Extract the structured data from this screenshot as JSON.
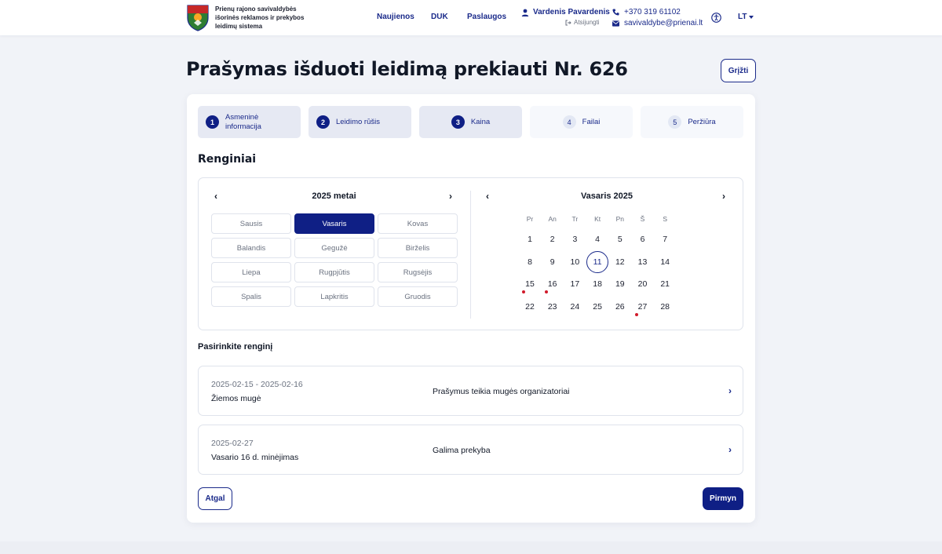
{
  "header": {
    "org_name": "Prienų rajono savivaldybės išorinės reklamos ir prekybos leidimų sistema",
    "nav": [
      "Naujienos",
      "DUK",
      "Paslaugos"
    ],
    "user_name": "Vardenis Pavardenis",
    "logout_label": "Atsijungti",
    "phone": "+370 319 61102",
    "email": "savivaldybe@prienai.lt",
    "language": "LT"
  },
  "page": {
    "title": "Prašymas išduoti leidimą prekiauti Nr. 626",
    "back_label": "Grįžti"
  },
  "steps": [
    {
      "num": "1",
      "label": "Asmeninė informacija",
      "state": "active"
    },
    {
      "num": "2",
      "label": "Leidimo rūšis",
      "state": "active"
    },
    {
      "num": "3",
      "label": "Kaina",
      "state": "active"
    },
    {
      "num": "4",
      "label": "Failai",
      "state": "inactive"
    },
    {
      "num": "5",
      "label": "Peržiūra",
      "state": "inactive"
    }
  ],
  "events_section": {
    "title": "Renginiai",
    "year_label": "2025 metai",
    "months": [
      "Sausis",
      "Vasaris",
      "Kovas",
      "Balandis",
      "Gegužė",
      "Birželis",
      "Liepa",
      "Rugpjūtis",
      "Rugsėjis",
      "Spalis",
      "Lapkritis",
      "Gruodis"
    ],
    "selected_month": "Vasaris",
    "calendar_label": "Vasaris 2025",
    "weekdays": [
      "Pr",
      "An",
      "Tr",
      "Kt",
      "Pn",
      "Š",
      "S"
    ],
    "weeks": [
      [
        "1",
        "2",
        "3",
        "4",
        "5",
        "6",
        "7"
      ],
      [
        "8",
        "9",
        "10",
        "11",
        "12",
        "13",
        "14"
      ],
      [
        "15",
        "16",
        "17",
        "18",
        "19",
        "20",
        "21"
      ],
      [
        "22",
        "23",
        "24",
        "25",
        "26",
        "27",
        "28"
      ]
    ],
    "today": "11",
    "event_days": [
      "15",
      "16",
      "27"
    ]
  },
  "select_event": {
    "title": "Pasirinkite renginį",
    "events": [
      {
        "date": "2025-02-15 - 2025-02-16",
        "name": "Žiemos mugė",
        "note": "Prašymus teikia mugės organizatoriai"
      },
      {
        "date": "2025-02-27",
        "name": "Vasario 16 d. minėjimas",
        "note": "Galima prekyba"
      }
    ]
  },
  "footer_buttons": {
    "back": "Atgal",
    "next": "Pirmyn"
  },
  "colors": {
    "primary": "#0f1f85",
    "event_dot": "#d11a2a",
    "background": "#f1f3f8"
  }
}
